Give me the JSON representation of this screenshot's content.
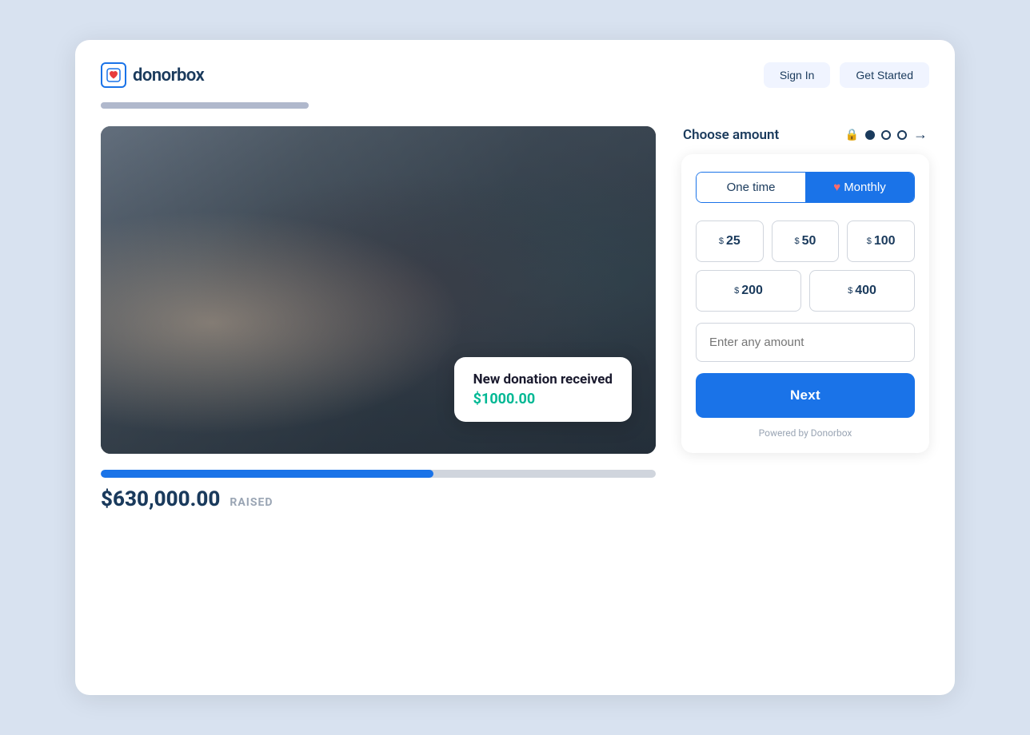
{
  "header": {
    "logo_text": "donorbox",
    "btn1_label": "Sign In",
    "btn2_label": "Get Started"
  },
  "top_progress": {
    "aria": "page loading indicator"
  },
  "campaign": {
    "raised_amount": "$630,000.00",
    "raised_label": "RAISED",
    "progress_percent": 60,
    "notification": {
      "title": "New donation received",
      "amount": "$1000.00"
    }
  },
  "donation_panel": {
    "header_title": "Choose amount",
    "frequency": {
      "one_time_label": "One time",
      "monthly_label": "Monthly",
      "active": "monthly"
    },
    "amounts": [
      {
        "value": "25",
        "display": "25"
      },
      {
        "value": "50",
        "display": "50"
      },
      {
        "value": "100",
        "display": "100"
      },
      {
        "value": "200",
        "display": "200"
      },
      {
        "value": "400",
        "display": "400"
      }
    ],
    "custom_amount_placeholder": "Enter any amount",
    "next_button_label": "Next",
    "powered_by": "Powered by Donorbox"
  }
}
